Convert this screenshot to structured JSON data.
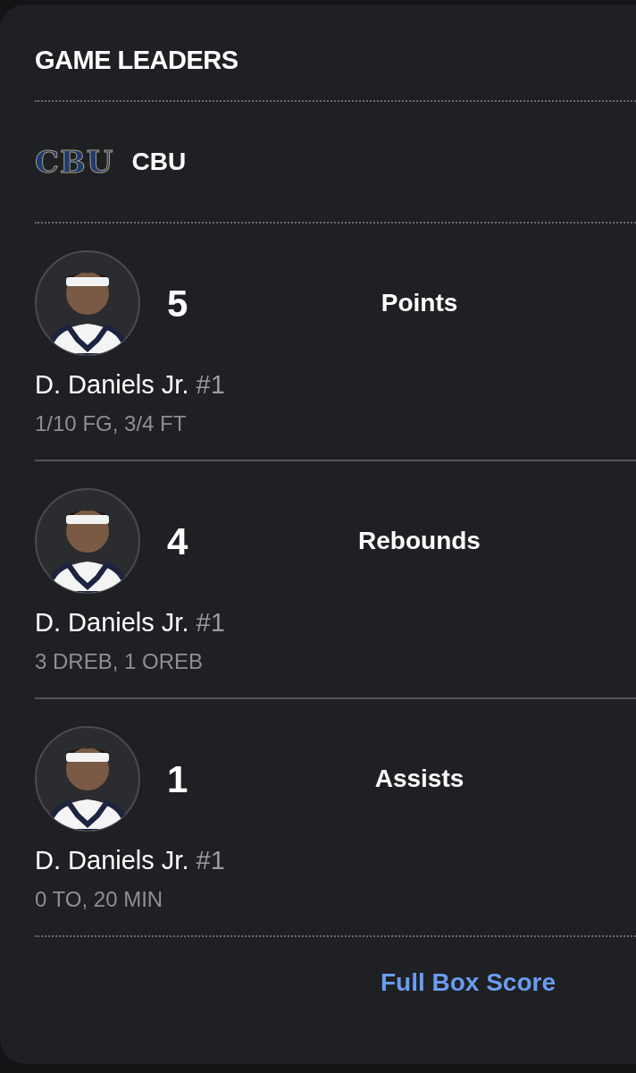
{
  "section_title": "GAME LEADERS",
  "team": {
    "logo_text": "CBU",
    "name": "CBU"
  },
  "leaders": [
    {
      "value": "5",
      "category": "Points",
      "player": "D. Daniels Jr.",
      "number": "#1",
      "stats": "1/10 FG, 3/4 FT"
    },
    {
      "value": "4",
      "category": "Rebounds",
      "player": "D. Daniels Jr.",
      "number": "#1",
      "stats": "3 DREB, 1 OREB"
    },
    {
      "value": "1",
      "category": "Assists",
      "player": "D. Daniels Jr.",
      "number": "#1",
      "stats": "0 TO, 20 MIN"
    }
  ],
  "link": "Full Box Score"
}
